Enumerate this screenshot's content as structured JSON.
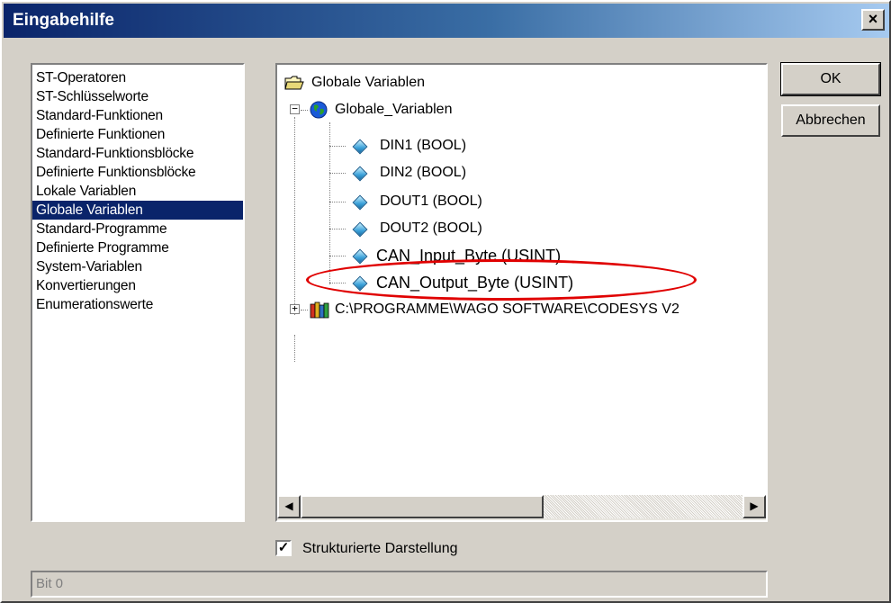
{
  "window": {
    "title": "Eingabehilfe",
    "close_label": "×"
  },
  "categories": [
    {
      "label": "ST-Operatoren"
    },
    {
      "label": "ST-Schlüsselworte"
    },
    {
      "label": "Standard-Funktionen"
    },
    {
      "label": "Definierte Funktionen"
    },
    {
      "label": "Standard-Funktionsblöcke"
    },
    {
      "label": "Definierte Funktionsblöcke"
    },
    {
      "label": "Lokale Variablen"
    },
    {
      "label": "Globale Variablen",
      "selected": true
    },
    {
      "label": "Standard-Programme"
    },
    {
      "label": "Definierte Programme"
    },
    {
      "label": "System-Variablen"
    },
    {
      "label": "Konvertierungen"
    },
    {
      "label": "Enumerationswerte"
    }
  ],
  "tree": {
    "root_label": "Globale Variablen",
    "group_label": "Globale_Variablen",
    "group_expander": "−",
    "variables": [
      {
        "label": "DIN1 (BOOL)"
      },
      {
        "label": "DIN2 (BOOL)"
      },
      {
        "label": "DOUT1 (BOOL)"
      },
      {
        "label": "DOUT2 (BOOL)"
      },
      {
        "label": "CAN_Input_Byte (USINT)"
      },
      {
        "label": "CAN_Output_Byte (USINT)"
      }
    ],
    "library_label": "C:\\PROGRAMME\\WAGO SOFTWARE\\CODESYS V2",
    "library_expander": "+"
  },
  "scrollbar": {
    "left_arrow": "◀",
    "right_arrow": "▶"
  },
  "buttons": {
    "ok_label": "OK",
    "cancel_label": "Abbrechen"
  },
  "options": {
    "structured_label": "Strukturierte Darstellung",
    "structured_checked": true,
    "check_mark": "✓"
  },
  "status": {
    "value": "Bit 0"
  },
  "colors": {
    "title_gradient_start": "#0a246a",
    "selection": "#0a246a",
    "highlight_ellipse": "#e00000",
    "face": "#d4d0c8"
  }
}
